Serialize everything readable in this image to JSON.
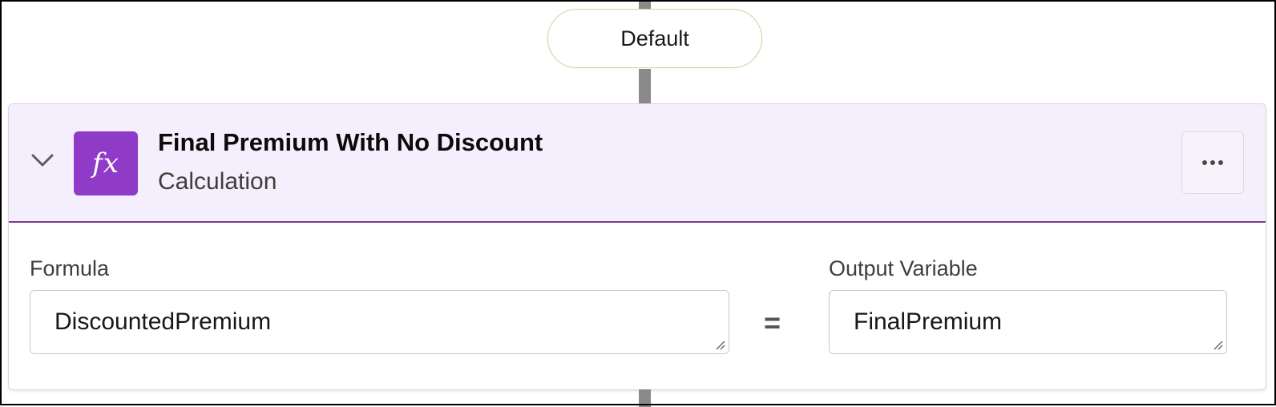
{
  "flow": {
    "branch_label": "Default"
  },
  "element": {
    "title": "Final Premium With No Discount",
    "type": "Calculation",
    "icon_text": "fx",
    "icon_color": "#8f3bc7",
    "header_bg": "#f5eefc"
  },
  "formula": {
    "label": "Formula",
    "value": "DiscountedPremium"
  },
  "operator": "=",
  "output": {
    "label": "Output Variable",
    "value": "FinalPremium"
  },
  "icons": {
    "collapse": "chevron-down-icon",
    "menu": "more-actions-icon",
    "formula": "function-icon",
    "resize": "resize-grip-icon"
  }
}
